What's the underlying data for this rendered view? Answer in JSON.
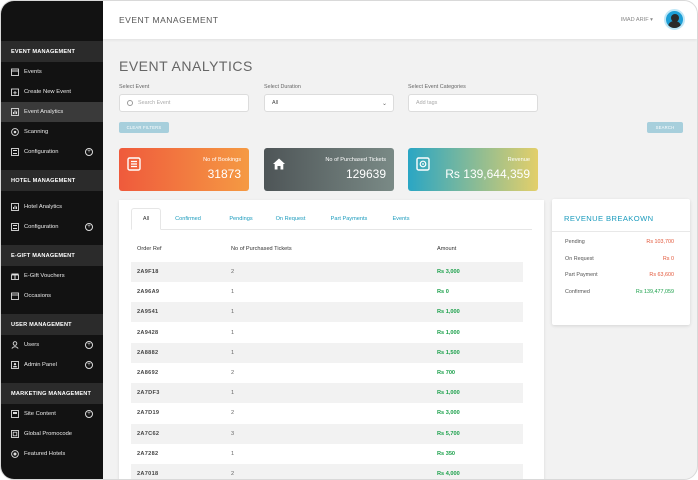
{
  "header": {
    "title": "EVENT MANAGEMENT",
    "user": "IMAD ARIF ▾"
  },
  "sidebar": {
    "sections": [
      {
        "title": "EVENT MANAGEMENT",
        "items": [
          {
            "label": "Events",
            "icon": "calendar-icon",
            "plus": false,
            "active": false
          },
          {
            "label": "Create New Event",
            "icon": "calendar-plus-icon",
            "plus": false,
            "active": false
          },
          {
            "label": "Event Analytics",
            "icon": "chart-icon",
            "plus": false,
            "active": true
          },
          {
            "label": "Scanning",
            "icon": "scan-icon",
            "plus": false,
            "active": false
          },
          {
            "label": "Configuration",
            "icon": "config-icon",
            "plus": true,
            "active": false
          }
        ]
      },
      {
        "title": "HOTEL MANAGEMENT",
        "items": [
          {
            "label": "Hotel Analytics",
            "icon": "chart-icon",
            "plus": false,
            "active": false
          },
          {
            "label": "Configuration",
            "icon": "config-icon",
            "plus": true,
            "active": false
          }
        ]
      },
      {
        "title": "E-GIFT MANAGEMENT",
        "items": [
          {
            "label": "E-Gift Vouchers",
            "icon": "gift-icon",
            "plus": false,
            "active": false
          },
          {
            "label": "Occasions",
            "icon": "calendar-icon",
            "plus": false,
            "active": false
          }
        ]
      },
      {
        "title": "USER MANAGEMENT",
        "items": [
          {
            "label": "Users",
            "icon": "user-icon",
            "plus": true,
            "active": false
          },
          {
            "label": "Admin Panel",
            "icon": "admin-icon",
            "plus": true,
            "active": false
          }
        ]
      },
      {
        "title": "MARKETING MANAGEMENT",
        "items": [
          {
            "label": "Site Content",
            "icon": "content-icon",
            "plus": true,
            "active": false
          },
          {
            "label": "Global Promocode",
            "icon": "promo-icon",
            "plus": false,
            "active": false
          },
          {
            "label": "Featured Hotels",
            "icon": "star-icon",
            "plus": false,
            "active": false
          }
        ]
      }
    ]
  },
  "main": {
    "page_title": "EVENT ANALYTICS",
    "filters": {
      "event_label": "Select Event",
      "event_placeholder": "Search Event",
      "duration_label": "Select Duration",
      "duration_value": "All",
      "category_label": "Select Event Categories",
      "category_placeholder": "Add tags",
      "clear_label": "CLEAR FILTERS",
      "search_label": "SEARCH"
    },
    "cards": [
      {
        "label": "No of Bookings",
        "value": "31873",
        "icon": "list-icon",
        "colors": [
          "#ef5a3c",
          "#f59a43"
        ]
      },
      {
        "label": "No of Purchased Tickets",
        "value": "129639",
        "icon": "home-icon",
        "colors": [
          "#4e5557",
          "#7a8a86"
        ]
      },
      {
        "label": "Revenue",
        "value": "Rs 139,644,359",
        "icon": "safe-icon",
        "colors": [
          "#2aa6c4",
          "#e3cf6a"
        ]
      }
    ],
    "tabs": [
      "All",
      "Confirmed",
      "Pendings",
      "On Request",
      "Part Payments",
      "Events"
    ],
    "table": {
      "headers": [
        "Order Ref",
        "No of Purchased Tickets",
        "Amount"
      ],
      "rows": [
        [
          "2A9F18",
          "2",
          "Rs 3,000"
        ],
        [
          "2A96A9",
          "1",
          "Rs 0"
        ],
        [
          "2A9541",
          "1",
          "Rs 1,000"
        ],
        [
          "2A9428",
          "1",
          "Rs 1,000"
        ],
        [
          "2A8882",
          "1",
          "Rs 1,500"
        ],
        [
          "2A8692",
          "2",
          "Rs 700"
        ],
        [
          "2A7DF3",
          "1",
          "Rs 1,000"
        ],
        [
          "2A7D19",
          "2",
          "Rs 3,000"
        ],
        [
          "2A7C62",
          "3",
          "Rs 5,700"
        ],
        [
          "2A7282",
          "1",
          "Rs 350"
        ],
        [
          "2A7018",
          "2",
          "Rs 4,000"
        ]
      ]
    }
  },
  "revenue": {
    "title": "REVENUE BREAKOWN",
    "rows": [
      {
        "label": "Pending",
        "value": "Rs 103,700",
        "color": "#e2573a"
      },
      {
        "label": "On Request",
        "value": "Rs 0",
        "color": "#e2573a"
      },
      {
        "label": "Part Payment",
        "value": "Rs 63,600",
        "color": "#e2573a"
      },
      {
        "label": "Confirmed",
        "value": "Rs 139,477,059",
        "color": "#1aa04a"
      }
    ]
  }
}
